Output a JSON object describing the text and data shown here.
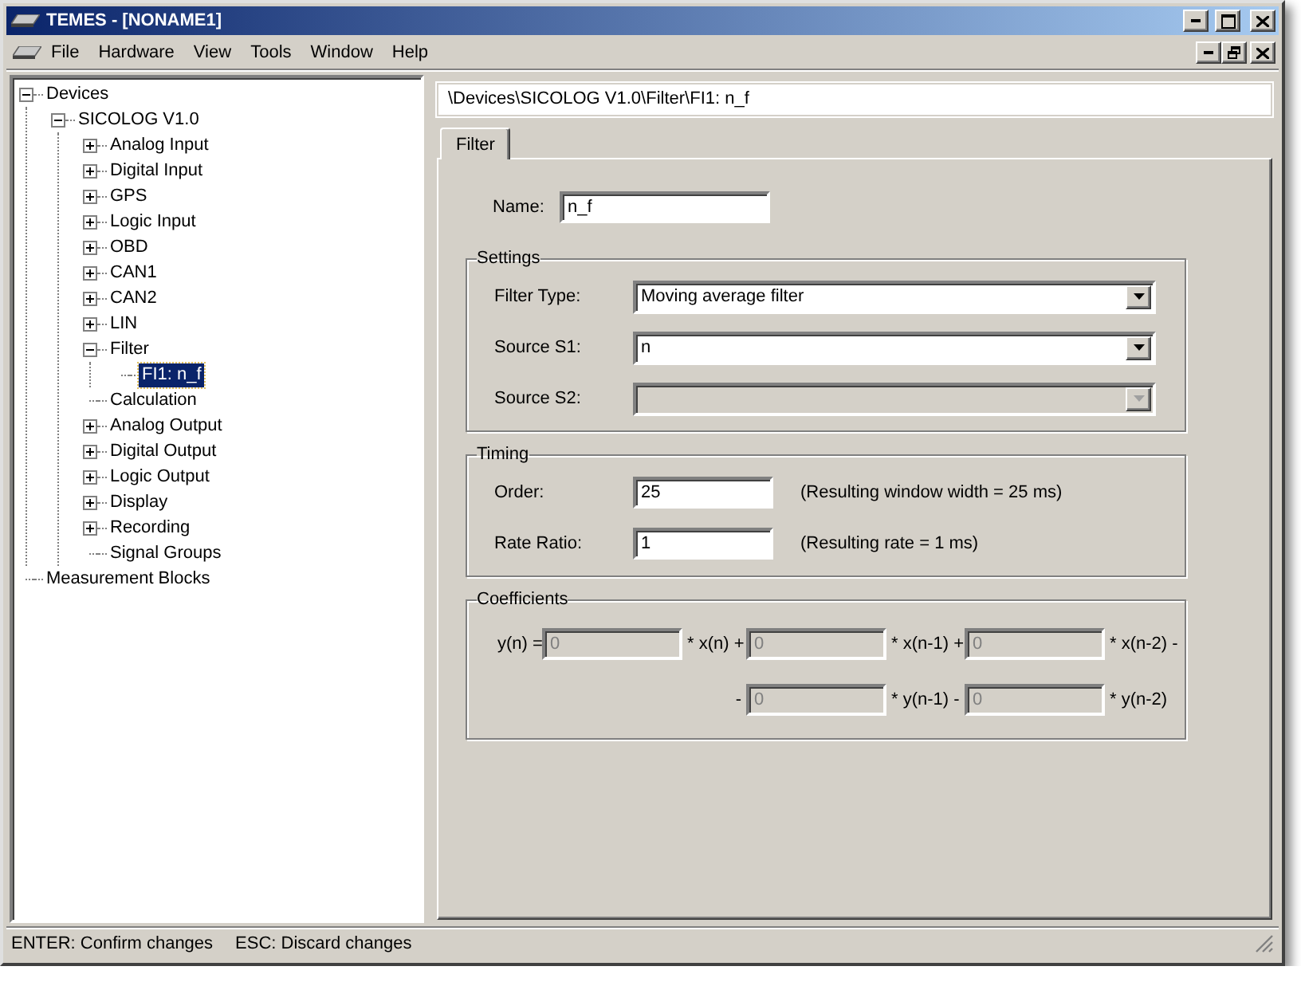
{
  "window": {
    "title": "TEMES - [NONAME1]"
  },
  "menu": [
    "File",
    "Hardware",
    "View",
    "Tools",
    "Window",
    "Help"
  ],
  "tree": [
    {
      "label": "Devices",
      "expanded": true,
      "selected": false,
      "children": [
        {
          "label": "SICOLOG V1.0",
          "expanded": true,
          "selected": false,
          "children": [
            {
              "label": "Analog Input",
              "expanded": false,
              "selected": false
            },
            {
              "label": "Digital Input",
              "expanded": false,
              "selected": false
            },
            {
              "label": "GPS",
              "expanded": false,
              "selected": false
            },
            {
              "label": "Logic Input",
              "expanded": false,
              "selected": false
            },
            {
              "label": "OBD",
              "expanded": false,
              "selected": false
            },
            {
              "label": "CAN1",
              "expanded": false,
              "selected": false
            },
            {
              "label": "CAN2",
              "expanded": false,
              "selected": false
            },
            {
              "label": "LIN",
              "expanded": false,
              "selected": false
            },
            {
              "label": "Filter",
              "expanded": true,
              "selected": false,
              "children": [
                {
                  "label": "FI1: n_f",
                  "selected": true
                }
              ]
            },
            {
              "label": "Calculation",
              "selected": false
            },
            {
              "label": "Analog Output",
              "expanded": false,
              "selected": false
            },
            {
              "label": "Digital Output",
              "expanded": false,
              "selected": false
            },
            {
              "label": "Logic Output",
              "expanded": false,
              "selected": false
            },
            {
              "label": "Display",
              "expanded": false,
              "selected": false
            },
            {
              "label": "Recording",
              "expanded": false,
              "selected": false
            },
            {
              "label": "Signal Groups",
              "selected": false
            }
          ]
        }
      ]
    },
    {
      "label": "Measurement Blocks",
      "selected": false
    }
  ],
  "path": "\\Devices\\SICOLOG V1.0\\Filter\\FI1: n_f",
  "tabs": [
    {
      "label": "Filter",
      "selected": true
    }
  ],
  "name_field": {
    "label": "Name:",
    "value": "n_f"
  },
  "settings": {
    "title": "Settings",
    "rows": [
      {
        "label": "Filter Type:",
        "value": "Moving average filter",
        "disabled": false
      },
      {
        "label": "Source S1:",
        "value": "n",
        "disabled": false
      },
      {
        "label": "Source S2:",
        "disabled": true
      }
    ]
  },
  "timing": {
    "title": "Timing",
    "rows": [
      {
        "label": "Order:",
        "value": "25",
        "note": "(Resulting window width = 25 ms)"
      },
      {
        "label": "Rate Ratio:",
        "value": "1",
        "note": "(Resulting rate = 1 ms)"
      }
    ]
  },
  "coefficients": {
    "title": "Coefficients",
    "rows": [
      {
        "parts": [
          {
            "kind": "text",
            "text": "y(n) ="
          },
          {
            "kind": "field",
            "value": "0",
            "disabled": true
          },
          {
            "kind": "text",
            "text": "* x(n) +"
          },
          {
            "kind": "field",
            "value": "0",
            "disabled": true
          },
          {
            "kind": "text",
            "text": "* x(n-1) +"
          },
          {
            "kind": "field",
            "value": "0",
            "disabled": true
          },
          {
            "kind": "text",
            "text": "* x(n-2) -"
          }
        ]
      },
      {
        "parts": [
          {
            "kind": "text",
            "text": "-"
          },
          {
            "kind": "field",
            "value": "0",
            "disabled": true
          },
          {
            "kind": "text",
            "text": "* y(n-1) -"
          },
          {
            "kind": "field",
            "value": "0",
            "disabled": true
          },
          {
            "kind": "text",
            "text": "* y(n-2)"
          }
        ]
      }
    ]
  },
  "status_bar": [
    "ENTER: Confirm changes",
    "ESC: Discard changes"
  ]
}
